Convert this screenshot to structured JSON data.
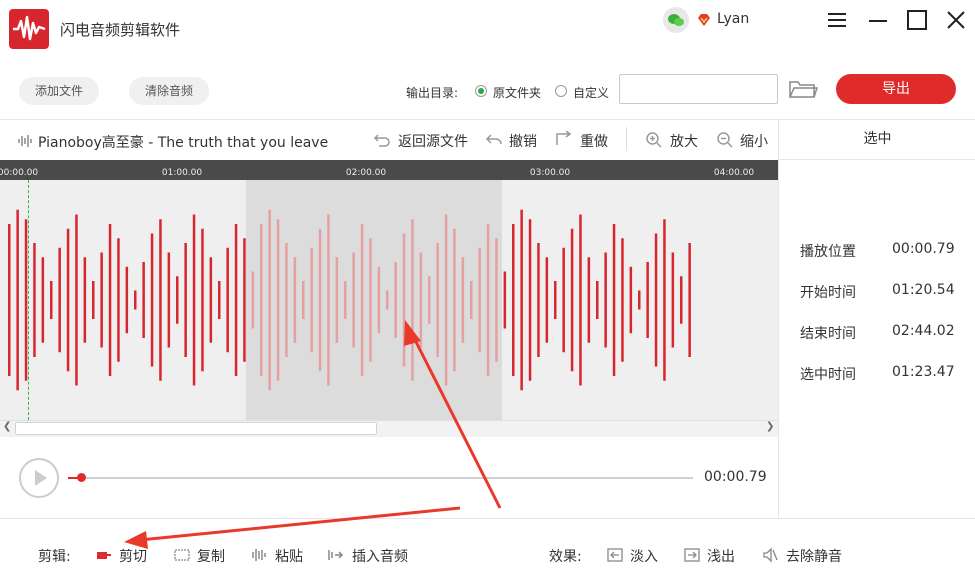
{
  "app": {
    "title": "闪电音频剪辑软件"
  },
  "user": {
    "name": "Lyan"
  },
  "toolbar": {
    "add_file": "添加文件",
    "clear_audio": "清除音频",
    "output_dir_label": "输出目录:",
    "option_source_folder": "原文件夹",
    "option_custom": "自定义",
    "selected_option": "原文件夹",
    "path_value": "",
    "export": "导出"
  },
  "track": {
    "name": "Pianoboy高至豪 - The truth that you leave",
    "back_to_source": "返回源文件",
    "undo": "撤销",
    "redo": "重做",
    "zoom_in": "放大",
    "zoom_out": "缩小"
  },
  "timeline": {
    "ticks": [
      "00:00.00",
      "01:00.00",
      "02:00.00",
      "03:00.00",
      "04:00.00"
    ]
  },
  "panel": {
    "title": "选中",
    "rows": [
      {
        "label": "播放位置",
        "value": "00:00.79"
      },
      {
        "label": "开始时间",
        "value": "01:20.54"
      },
      {
        "label": "结束时间",
        "value": "02:44.02"
      },
      {
        "label": "选中时间",
        "value": "01:23.47"
      }
    ]
  },
  "player": {
    "time": "00:00.79",
    "progress_fraction": 0.02
  },
  "edit": {
    "label": "剪辑:",
    "cut": "剪切",
    "copy": "复制",
    "paste": "粘贴",
    "insert_audio": "插入音频"
  },
  "effects": {
    "label": "效果:",
    "fade_in": "淡入",
    "fade_out": "浅出",
    "remove_silence": "去除静音"
  },
  "colors": {
    "accent": "#e02b2b",
    "waveform": "#d7262e",
    "waveform_selected": "#e6a0a0",
    "selection_bg": "#dcdcdc",
    "radio_on": "#2aa744"
  }
}
